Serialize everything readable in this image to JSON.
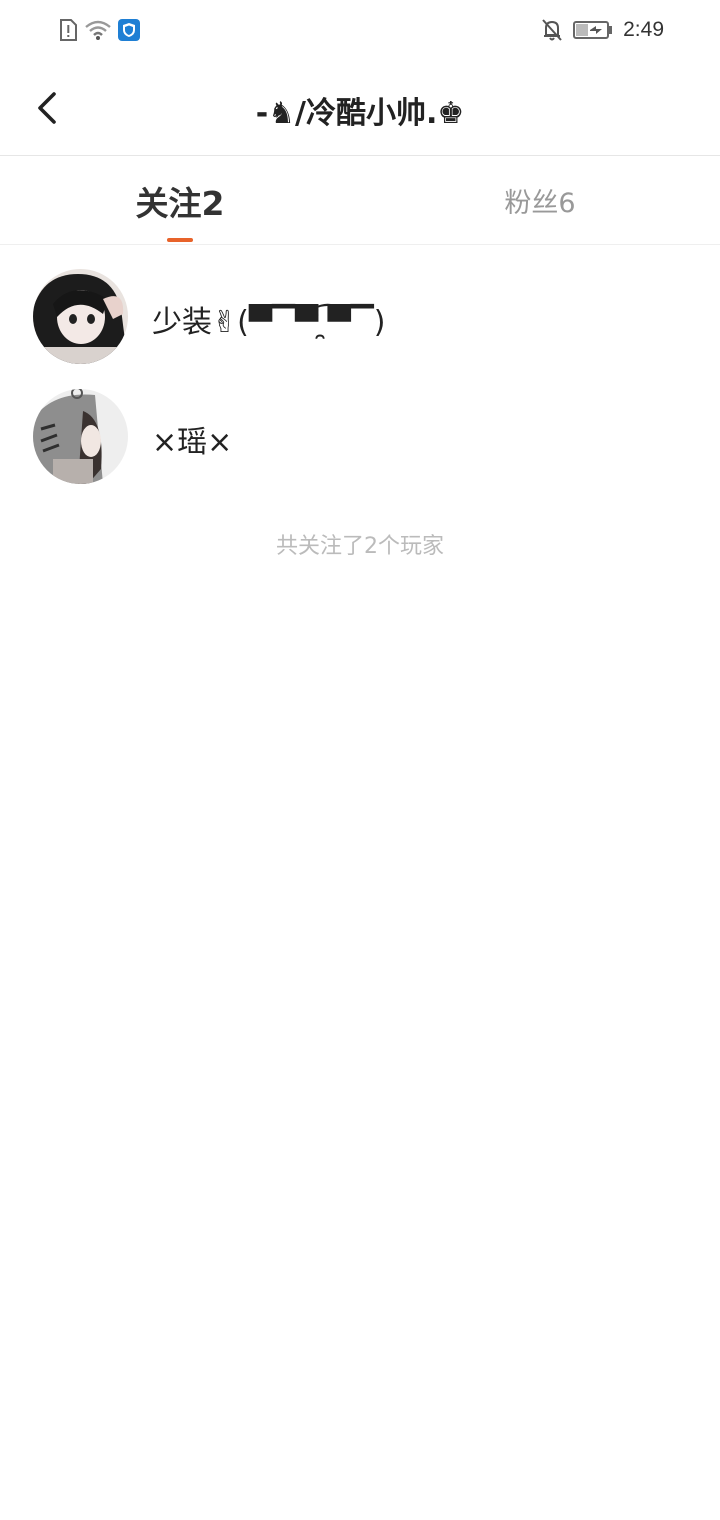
{
  "status_bar": {
    "time": "2:49",
    "left_icons": [
      "sim-alert-icon",
      "wifi-icon",
      "shield-app-icon"
    ],
    "right_icons": [
      "bell-muted-icon",
      "battery-icon"
    ]
  },
  "header": {
    "title": "-♞/冷酷小帅.♚",
    "back_icon": "chevron-left-icon"
  },
  "tabs": [
    {
      "label": "关注2",
      "active": true
    },
    {
      "label": "粉丝6",
      "active": false
    }
  ],
  "accent_color": "#e8632a",
  "following": [
    {
      "name": "少装✌(▀▔▀̿ ̯͡▀▔)"
    },
    {
      "name": "×瑶×"
    }
  ],
  "summary": "共关注了2个玩家"
}
